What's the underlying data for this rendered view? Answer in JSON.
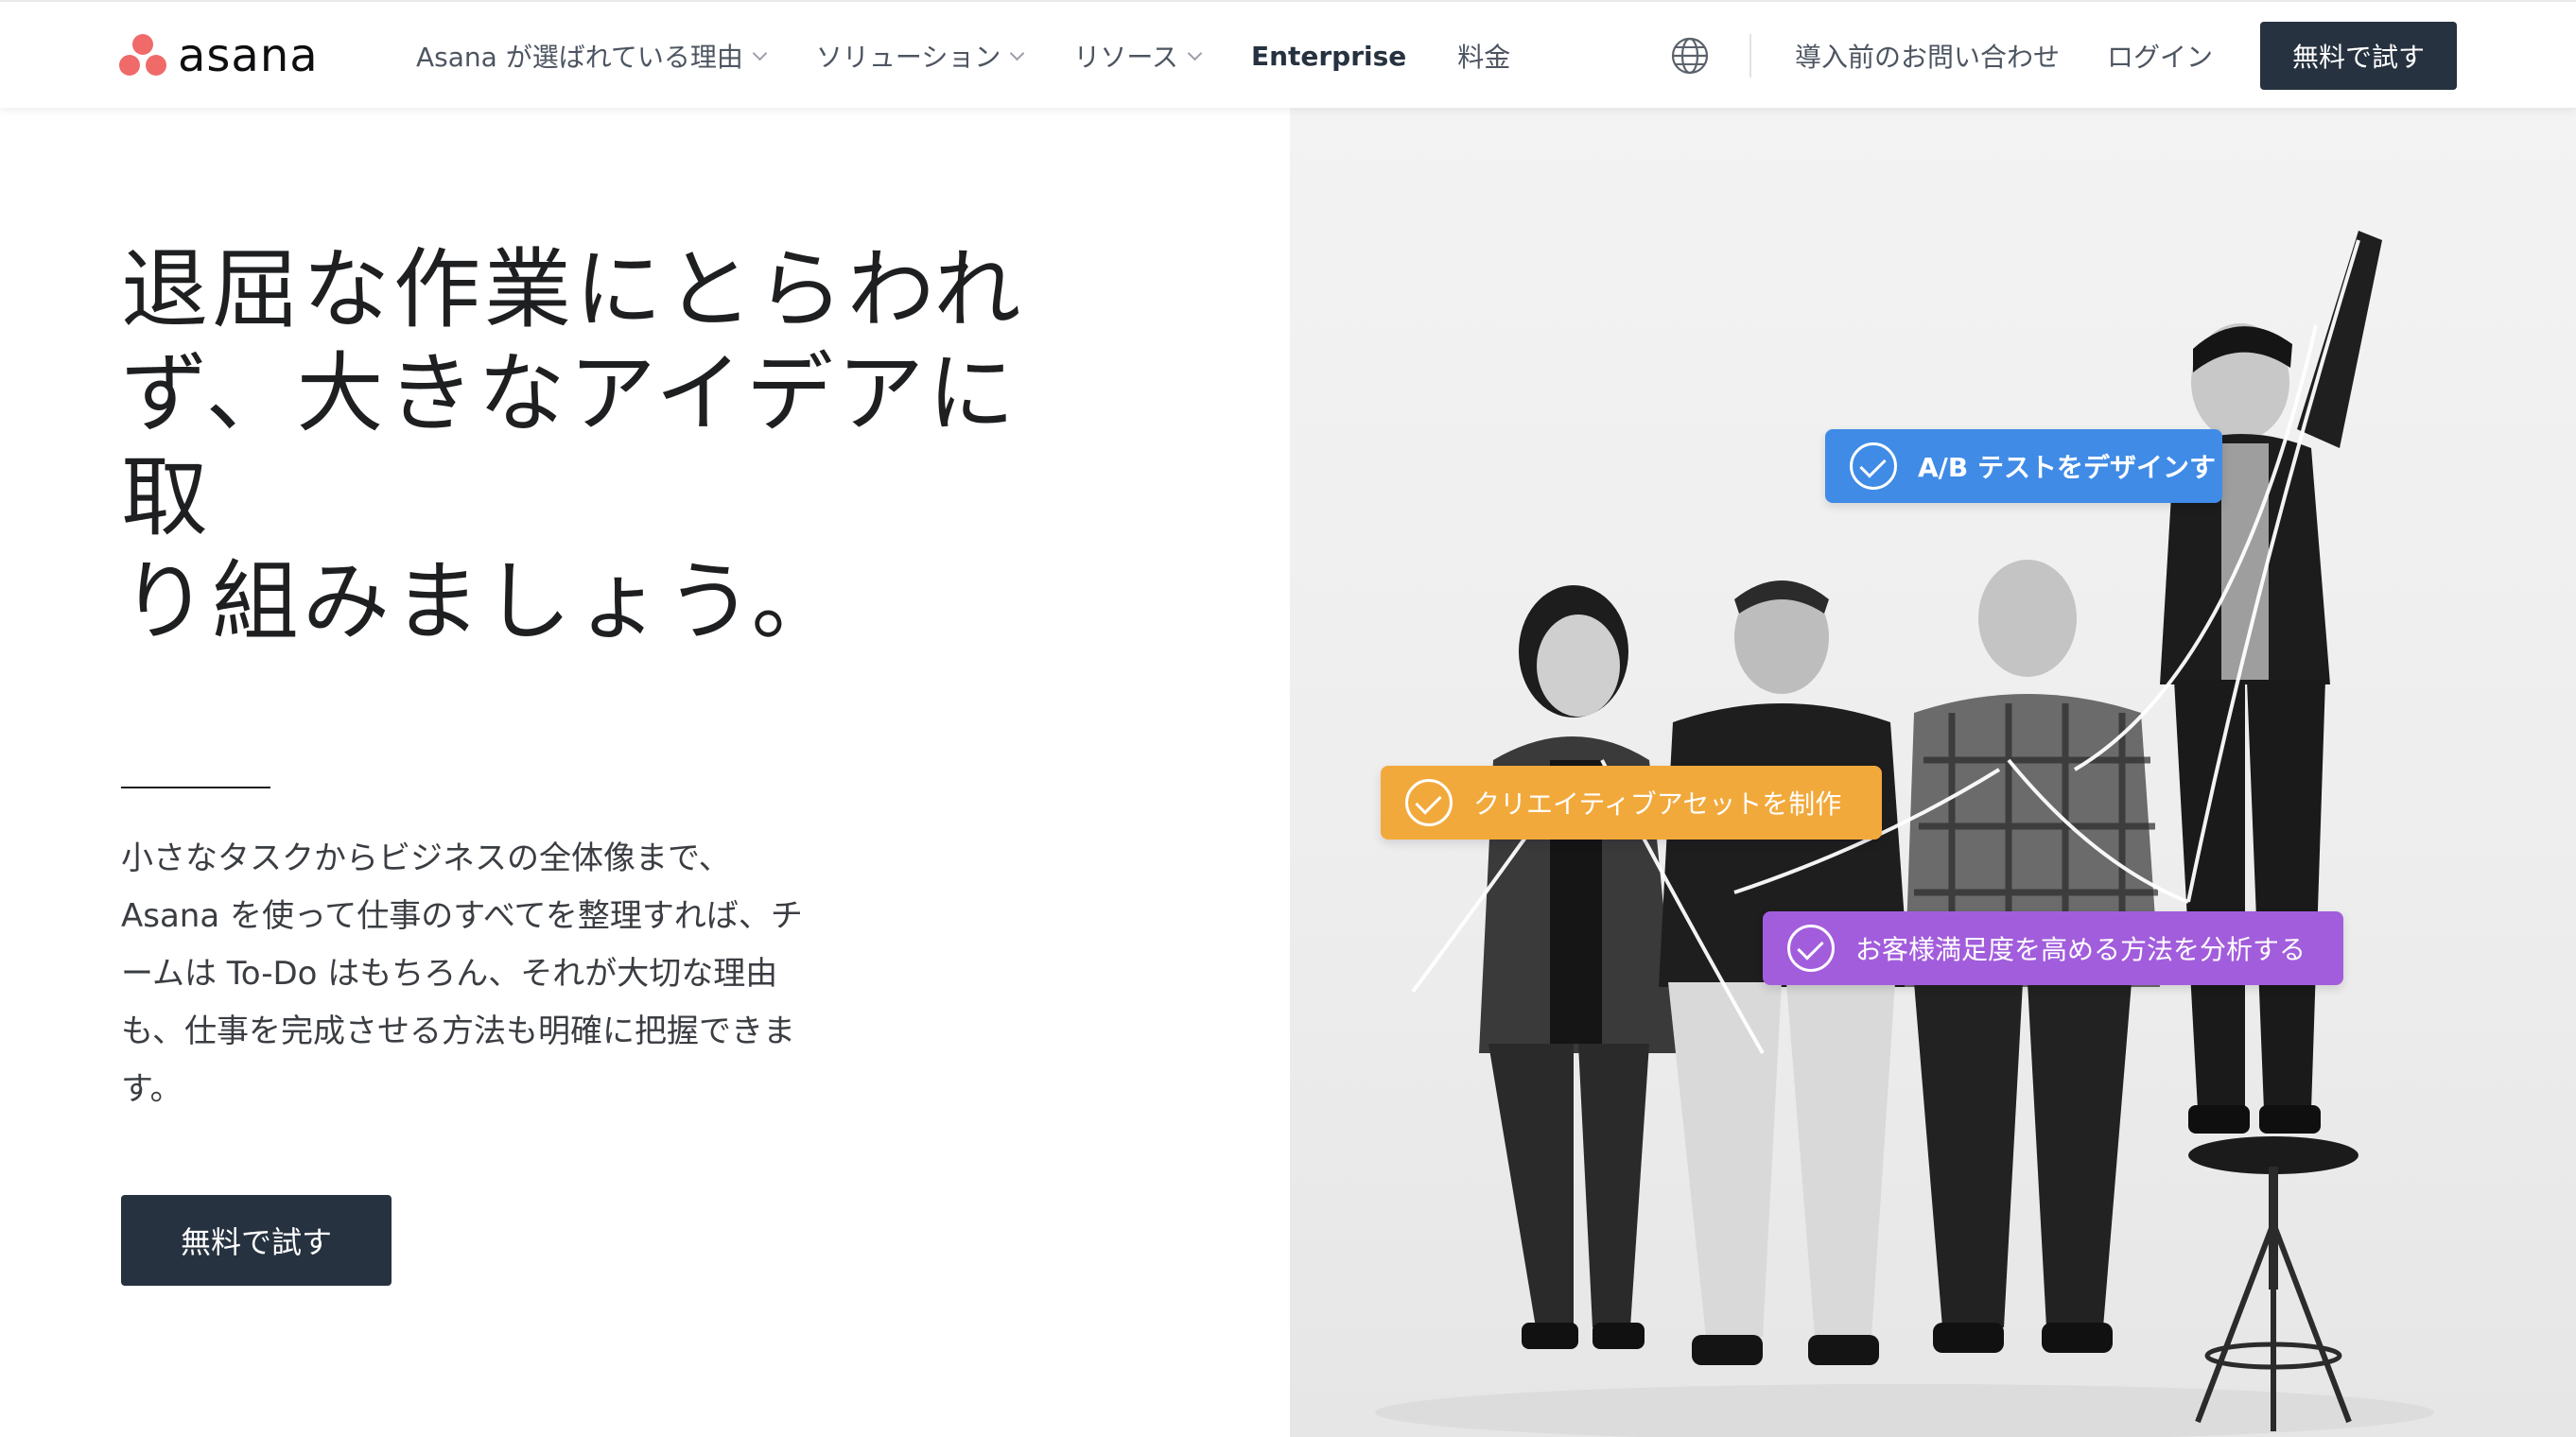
{
  "brand": {
    "name": "asana",
    "logo_color": "#f06a6a"
  },
  "nav": {
    "items": [
      {
        "label": "Asana が選ばれている理由",
        "dropdown": true
      },
      {
        "label": "ソリューション",
        "dropdown": true
      },
      {
        "label": "リソース",
        "dropdown": true
      },
      {
        "label": "Enterprise",
        "dropdown": false
      },
      {
        "label": "料金",
        "dropdown": false
      }
    ],
    "globe_icon": "globe-icon",
    "contact_label": "導入前のお問い合わせ",
    "login_label": "ログイン",
    "cta_label": "無料で試す"
  },
  "hero": {
    "title_lines": [
      "退屈な作業にとらわれ",
      "ず、大きなアイデアに取",
      "り組みましょう。"
    ],
    "description_lines": [
      "小さなタスクからビジネスの全体像まで、",
      "Asana を使って仕事のすべてを整理すれば、チ",
      "ームは To-Do はもちろん、それが大切な理由",
      "も、仕事を完成させる方法も明確に把握できま",
      "す。"
    ],
    "cta_label": "無料で試す"
  },
  "image_tags": [
    {
      "label": "A/B テストをデザインす",
      "color": "#3f8be6"
    },
    {
      "label": "クリエイティブアセットを制作",
      "color": "#f2a93b"
    },
    {
      "label": "お客様満足度を高める方法を分析する",
      "color": "#a25ddc"
    }
  ],
  "colors": {
    "button_dark": "#273240",
    "text_dark": "#1e1f21"
  }
}
